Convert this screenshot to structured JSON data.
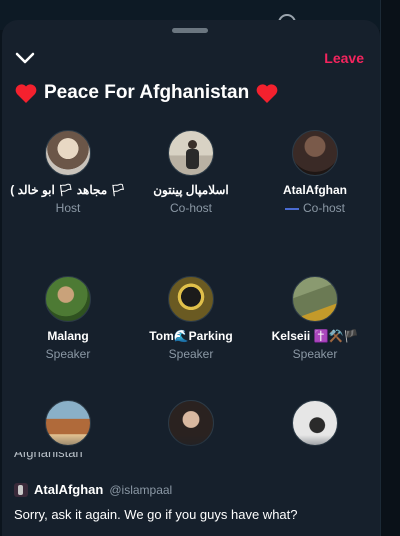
{
  "space": {
    "title": "Peace For Afghanistan",
    "leave_label": "Leave"
  },
  "participants": [
    {
      "name": "( مجاهد 🏳 ابو خالد 🏳",
      "role": "Host",
      "avatar_color": "#c9c3bb"
    },
    {
      "name": "اسلامپال پینتون",
      "role": "Co-host",
      "avatar_color": "#d8d2c4"
    },
    {
      "name": "AtalAfghan",
      "role": "Co-host",
      "avatar_color": "#3a2a26"
    },
    {
      "name": "Malang",
      "role": "Speaker",
      "avatar_color": "#4d7a34"
    },
    {
      "name": "Tom🌊Parking",
      "role": "Speaker",
      "avatar_color": "#6a5a22"
    },
    {
      "name": "Kelseii ✝️⚒️🏴",
      "role": "Speaker",
      "avatar_color": "#6b7a54"
    },
    {
      "name": "",
      "role": "",
      "avatar_color": "#b06a3a"
    },
    {
      "name": "",
      "role": "",
      "avatar_color": "#2a2220"
    },
    {
      "name": "",
      "role": "",
      "avatar_color": "#e6e6e6"
    }
  ],
  "partial_line": "Afghanistan",
  "comment": {
    "author": "AtalAfghan",
    "handle": "@islampaal",
    "text": "Sorry, ask it again. We go if you guys have what?"
  },
  "colors": {
    "accent": "#f4245e",
    "heart": "#f4212e",
    "sheet_bg": "#16202c",
    "muted_text": "#8b98a5"
  }
}
